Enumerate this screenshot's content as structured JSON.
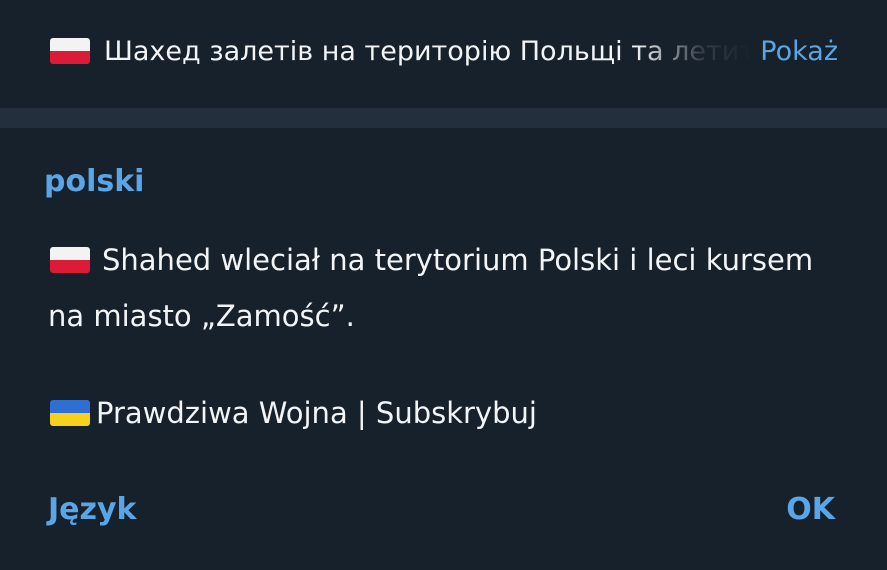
{
  "preview": {
    "flag_icon": "poland-flag-icon",
    "text": "Шахед залетів на територію Польщі та летить",
    "show_label": "Pokaż"
  },
  "dialog": {
    "language_title": "polski",
    "message": {
      "flag_icon": "poland-flag-icon",
      "line1": "Shahed wleciał na terytorium Polski i leci kursem",
      "line2": "na miasto „Zamość”."
    },
    "footer": {
      "flag_icon": "ukraine-flag-icon",
      "text": "Prawdziwa Wojna | Subskrybuj"
    },
    "buttons": {
      "language_label": "Język",
      "ok_label": "OK"
    }
  },
  "colors": {
    "background": "#17212b",
    "divider": "#232f3d",
    "accent": "#5aa5e6",
    "text": "#f2f4f6"
  }
}
